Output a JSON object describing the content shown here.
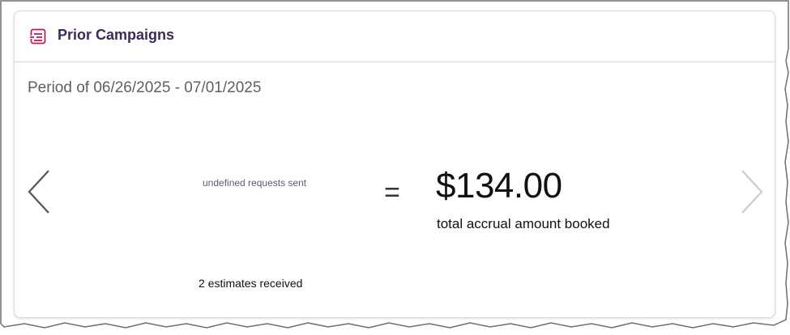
{
  "card": {
    "title": "Prior Campaigns",
    "title_icon": "campaign-list-icon",
    "period": "Period of 06/26/2025 - 07/01/2025",
    "requests_sent": "undefined requests sent",
    "equals": "=",
    "amount": "$134.00",
    "amount_label": "total accrual amount booked",
    "estimates_received": "2 estimates received",
    "prev_icon": "chevron-left-icon",
    "next_icon": "chevron-right-icon"
  },
  "colors": {
    "title": "#3b2a5c",
    "accent_icon": "#c2185b",
    "text_muted": "#5f5f5f",
    "text_primary": "#111111",
    "nav_active": "#555555",
    "nav_disabled": "#cccccc"
  }
}
